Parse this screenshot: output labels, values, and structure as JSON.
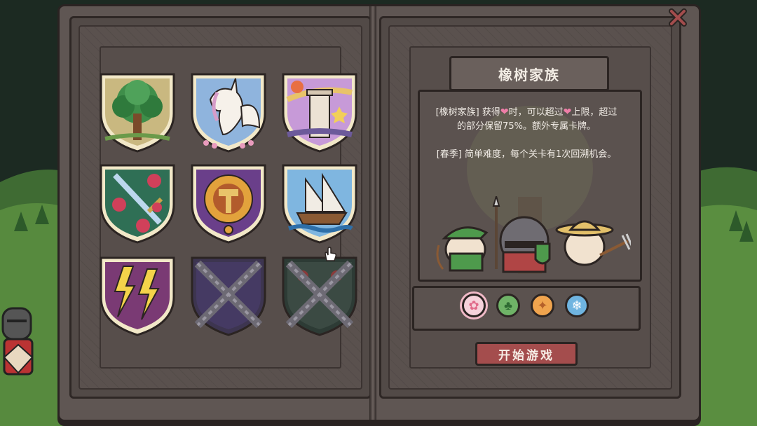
{
  "title": "橡树家族",
  "description": {
    "line1_prefix": "[橡树家族] 获得",
    "line1_mid": "时，可以超过",
    "line1_suffix": "上限，超过的部分保留75%。额外专属卡牌。",
    "line2": "[春季] 简单难度，每个关卡有1次回溯机会。"
  },
  "start_button_label": "开始游戏",
  "shields": [
    {
      "name": "tree",
      "locked": false
    },
    {
      "name": "unicorn",
      "locked": false
    },
    {
      "name": "tower",
      "locked": false
    },
    {
      "name": "sword-rose",
      "locked": false
    },
    {
      "name": "hammer-gear",
      "locked": false
    },
    {
      "name": "ship",
      "locked": false
    },
    {
      "name": "lightning",
      "locked": false
    },
    {
      "name": "chained",
      "locked": true
    },
    {
      "name": "chained-mushroom",
      "locked": true
    }
  ],
  "seasons": [
    {
      "name": "spring",
      "icon": "flower-icon",
      "selected": true
    },
    {
      "name": "summer",
      "icon": "tree-icon",
      "selected": false
    },
    {
      "name": "autumn",
      "icon": "leaf-icon",
      "selected": false
    },
    {
      "name": "winter",
      "icon": "snowflake-icon",
      "selected": false
    }
  ],
  "colors": {
    "accent_red": "#a44d4d",
    "heart_pink": "#ef7ea8",
    "page_bg": "#574e4b"
  }
}
